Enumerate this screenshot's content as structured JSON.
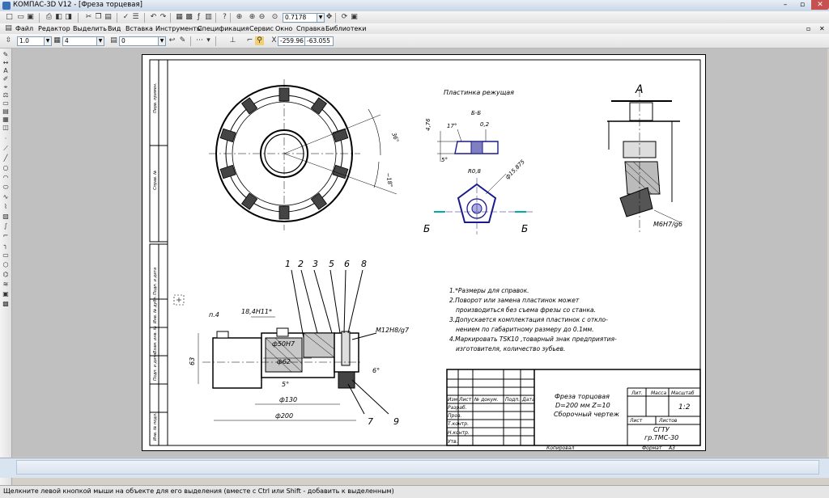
{
  "window": {
    "title": "КОМПАС-3D V12 - [Фреза торцевая]",
    "minimize": "–",
    "restore": "▫",
    "close": "✕",
    "doc_close": "✕",
    "doc_restore": "▫"
  },
  "menu": [
    "Файл",
    "Редактор",
    "Выделить",
    "Вид",
    "Вставка",
    "Инструменты",
    "Спецификация",
    "Сервис",
    "Окно",
    "Справка",
    "Библиотеки"
  ],
  "toolbar": {
    "zoom_value": "0.7178"
  },
  "props": {
    "line_scale": "1.0",
    "layer": "4",
    "style": "0",
    "coord_x": "-259.96",
    "coord_y": "-63.055",
    "x_label": "X",
    "y_label": "Y"
  },
  "icons": {
    "new": "new-icon",
    "open": "open-icon",
    "save": "save-icon",
    "print": "print-icon",
    "cut": "cut-icon",
    "copy": "copy-icon",
    "paste": "paste-icon",
    "undo": "undo-icon",
    "redo": "redo-icon",
    "zoom": "zoom-icon",
    "pan": "pan-icon"
  },
  "drawing": {
    "blade_title": "Пластинка режущая",
    "section_label": "Б-Б",
    "view_label": "A",
    "section_marker": "Б",
    "dim_476": "4,76",
    "dim_17": "17°",
    "dim_02": "0,2",
    "dim_5": "5°",
    "dim_r08": "R0,8",
    "dim_15875": "ф15,875",
    "dim_36a": "36°",
    "dim_18": "~18°",
    "fit_m6": "M6H7/g6",
    "leaders": [
      "1",
      "2",
      "3",
      "5",
      "6",
      "8"
    ],
    "leaders_bottom": [
      "7",
      "9"
    ],
    "dim_184": "18,4H11*",
    "dim_p4": "п.4",
    "dim_50h7": "ф50H7",
    "dim_62": "ф62",
    "dim_63": "63",
    "dim_130": "ф130",
    "dim_200": "ф200",
    "dim_5deg": "5°",
    "dim_6deg": "6°",
    "thread": "M12H8/g7",
    "notes": [
      "1.*Размеры для справок.",
      "2.Поворот или замена пластинок может",
      "производиться без съема фрезы со станка.",
      "3.Допускается комплектация пластинок с откло-",
      "нением по габаритному размеру до 0.1мм.",
      "4.Маркировать  TSK10 ,товарный знак предприятия-",
      "изготовителя, количество зубьев."
    ],
    "side_labels": [
      "Перв. примен.",
      "Справ. №",
      "Подп. и дата",
      "Инв. № дубл.",
      "Взам. инв. №",
      "Подп. и дата",
      "Инв. № подл."
    ],
    "title_block": {
      "name1": "Фреза торцовая",
      "name2": "D=200 мм Z=10",
      "name3": "Сборочный чертеж",
      "lit": "Лит.",
      "mass": "Масса",
      "scale": "Масштаб",
      "scale_value": "1:2",
      "sheet": "Лист",
      "sheets": "Листов",
      "org1": "СГТУ",
      "org2": "гр.ТМС-30",
      "rows": [
        "Изм",
        "Лист",
        "№ докум.",
        "Подп.",
        "Дата"
      ],
      "people": [
        "Разраб.",
        "Пров.",
        "Т.контр.",
        "Н.контр.",
        "Утв."
      ],
      "copied": "Копировал",
      "format": "Формат",
      "format_value": "А3"
    }
  },
  "status": {
    "hint": "Щелкните левой кнопкой мыши на объекте для его выделения (вместе с Ctrl или Shift - добавить к выделенным)"
  }
}
